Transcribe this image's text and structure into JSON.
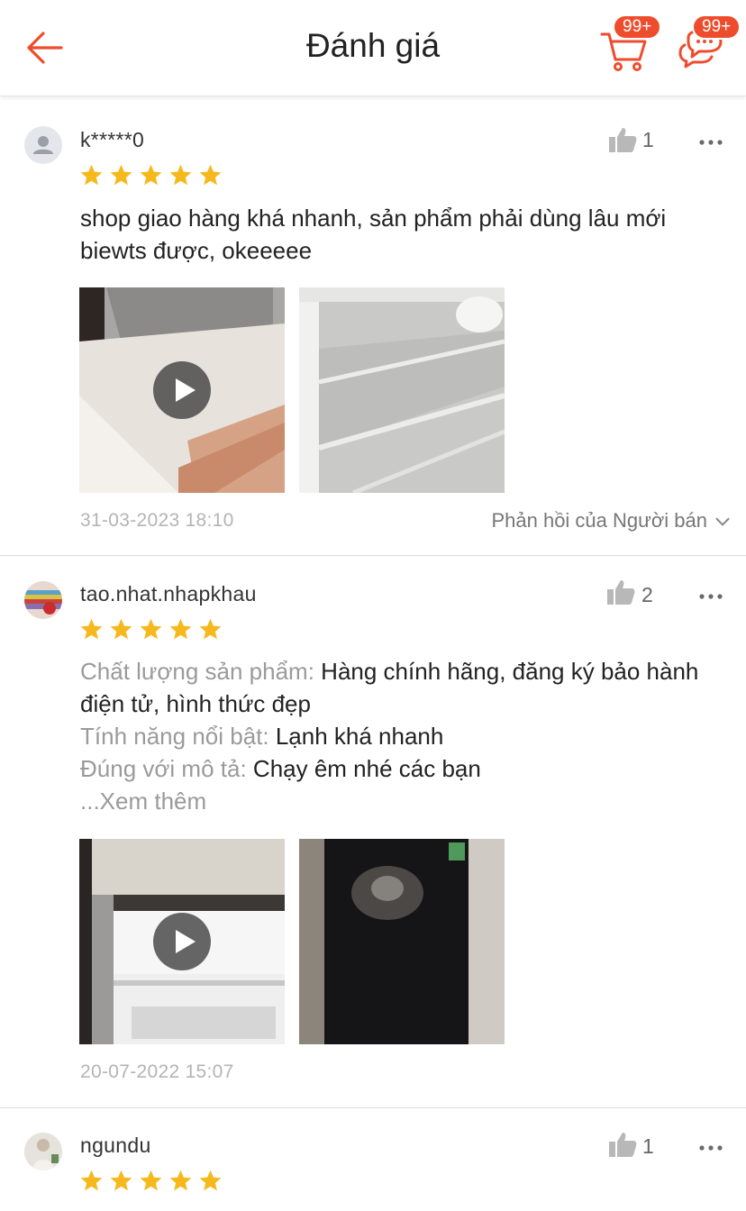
{
  "header": {
    "title": "Đánh giá",
    "cart_badge": "99+",
    "chat_badge": "99+",
    "back_icon": "arrow-left-icon",
    "cart_icon": "cart-icon",
    "chat_icon": "chat-icon",
    "accent": "#ee4d2d"
  },
  "reviews": [
    {
      "username": "k*****0",
      "likes": "1",
      "rating": 5,
      "text": "shop giao hàng khá nhanh, sản phẩm phải dùng lâu mới biewts được, okeeeee",
      "date": "31-03-2023 18:10",
      "seller_reply_label": "Phản hồi của Người bán"
    },
    {
      "username": "tao.nhat.nhapkhau",
      "likes": "2",
      "rating": 5,
      "attributes": [
        {
          "label": "Chất lượng sản phẩm:",
          "value": "Hàng chính hãng, đăng ký bảo hành điện tử, hình thức đẹp"
        },
        {
          "label": "Tính năng nổi bật:",
          "value": "Lạnh khá nhanh"
        },
        {
          "label": "Đúng với mô tả:",
          "value": "Chạy êm nhé các bạn"
        }
      ],
      "see_more": "...Xem thêm",
      "date": "20-07-2022 15:07"
    },
    {
      "username": "ngundu",
      "likes": "1",
      "rating": 5
    }
  ]
}
